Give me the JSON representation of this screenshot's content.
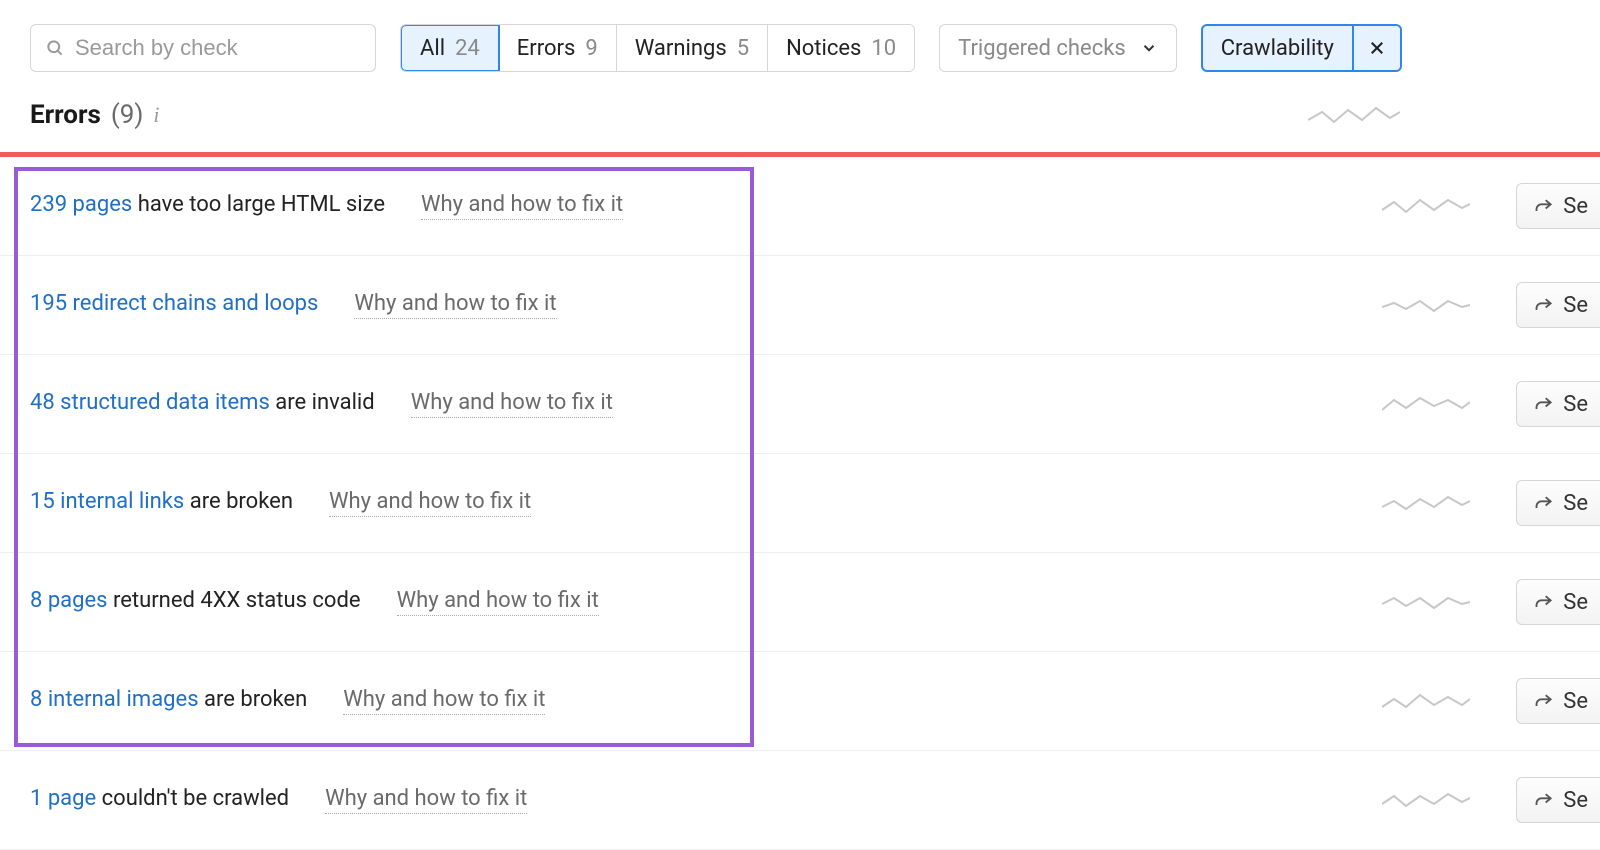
{
  "search": {
    "placeholder": "Search by check"
  },
  "tabs": [
    {
      "label": "All",
      "count": "24",
      "active": true
    },
    {
      "label": "Errors",
      "count": "9",
      "active": false
    },
    {
      "label": "Warnings",
      "count": "5",
      "active": false
    },
    {
      "label": "Notices",
      "count": "10",
      "active": false
    }
  ],
  "dropdown": {
    "label": "Triggered checks"
  },
  "chip": {
    "label": "Crawlability"
  },
  "section": {
    "name": "Errors",
    "count": "(9)"
  },
  "fix_label": "Why and how to fix it",
  "action_label": "Se",
  "issues": [
    {
      "link": "239 pages",
      "rest": " have too large HTML size"
    },
    {
      "link": "195 redirect chains and loops",
      "rest": ""
    },
    {
      "link": "48 structured data items",
      "rest": " are invalid"
    },
    {
      "link": "15 internal links",
      "rest": " are broken"
    },
    {
      "link": "8 pages",
      "rest": " returned 4XX status code"
    },
    {
      "link": "8 internal images",
      "rest": " are broken"
    },
    {
      "link": "1 page",
      "rest": " couldn't be crawled"
    }
  ]
}
